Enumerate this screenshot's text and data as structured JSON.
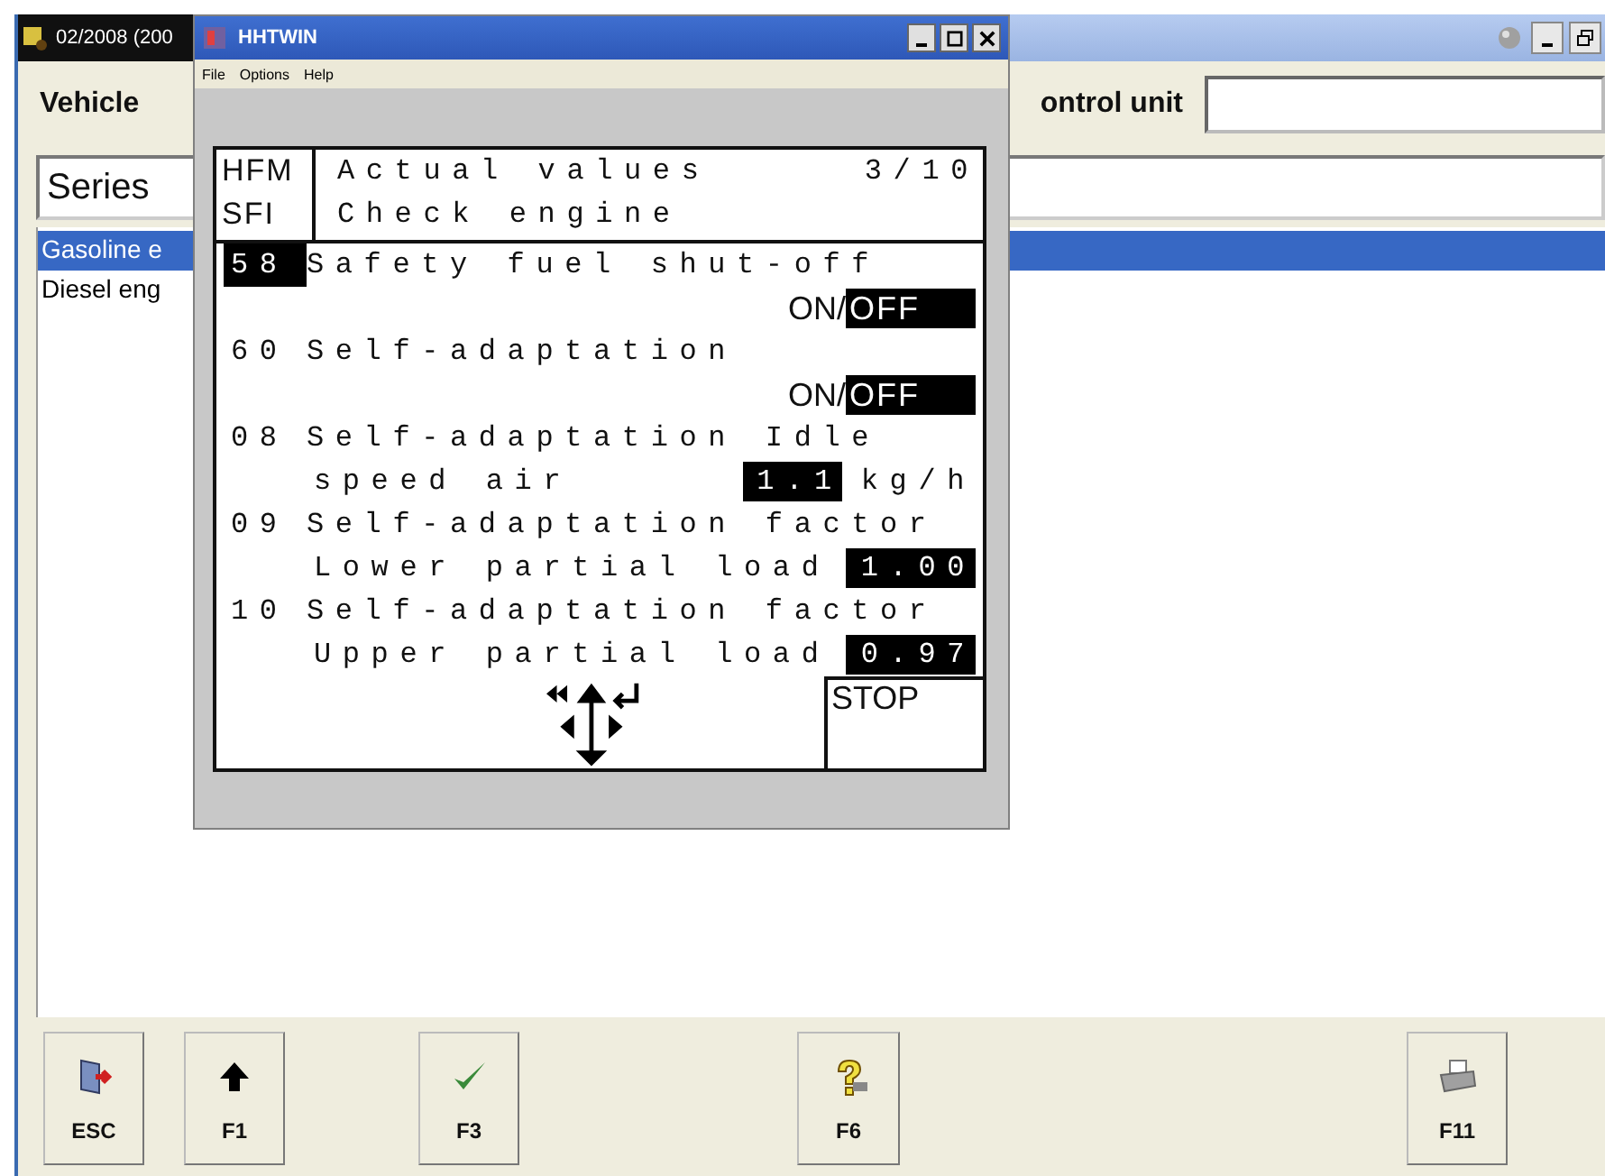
{
  "main_window": {
    "title": "02/2008 (200",
    "vehicle_label": "Vehicle",
    "control_unit_label": "ontrol unit",
    "series_field": {
      "value": "Series"
    },
    "list": [
      {
        "label": "Gasoline e",
        "selected": true
      },
      {
        "label": "Diesel eng",
        "selected": false
      }
    ],
    "function_keys": [
      {
        "label": "ESC",
        "kind": "exit"
      },
      {
        "label": "F1",
        "kind": "up"
      },
      {
        "label": "F3",
        "kind": "check"
      },
      {
        "label": "F6",
        "kind": "help"
      },
      {
        "label": "F11",
        "kind": "print"
      }
    ]
  },
  "hhtwin": {
    "title": "HHTWIN",
    "menu": [
      "File",
      "Options",
      "Help"
    ],
    "display": {
      "module": [
        "HFM",
        "SFI"
      ],
      "title": "Actual values",
      "page": "3/10",
      "subtitle": "Check engine",
      "rows": [
        {
          "id": "58",
          "selected": true,
          "label": "Safety fuel shut-off",
          "kind": "switch",
          "separator": "/",
          "options": [
            {
              "label": "ON",
              "selected": false
            },
            {
              "label": "OFF",
              "selected": true
            }
          ]
        },
        {
          "id": "60",
          "selected": false,
          "label": "Self-adaptation",
          "kind": "switch",
          "separator": "/",
          "options": [
            {
              "label": "ON",
              "selected": false
            },
            {
              "label": "OFF",
              "selected": true
            }
          ]
        },
        {
          "id": "08",
          "selected": false,
          "label": "Self-adaptation Idle",
          "kind": "value",
          "detail": "speed air",
          "value": "1.1",
          "unit": "kg/h"
        },
        {
          "id": "09",
          "selected": false,
          "label": "Self-adaptation factor",
          "kind": "value",
          "detail": "Lower partial load",
          "value": "1.00"
        },
        {
          "id": "10",
          "selected": false,
          "label": "Self-adaptation factor",
          "kind": "value",
          "detail": "Upper partial load",
          "value": "0.97"
        }
      ],
      "stop": "STOP"
    }
  }
}
